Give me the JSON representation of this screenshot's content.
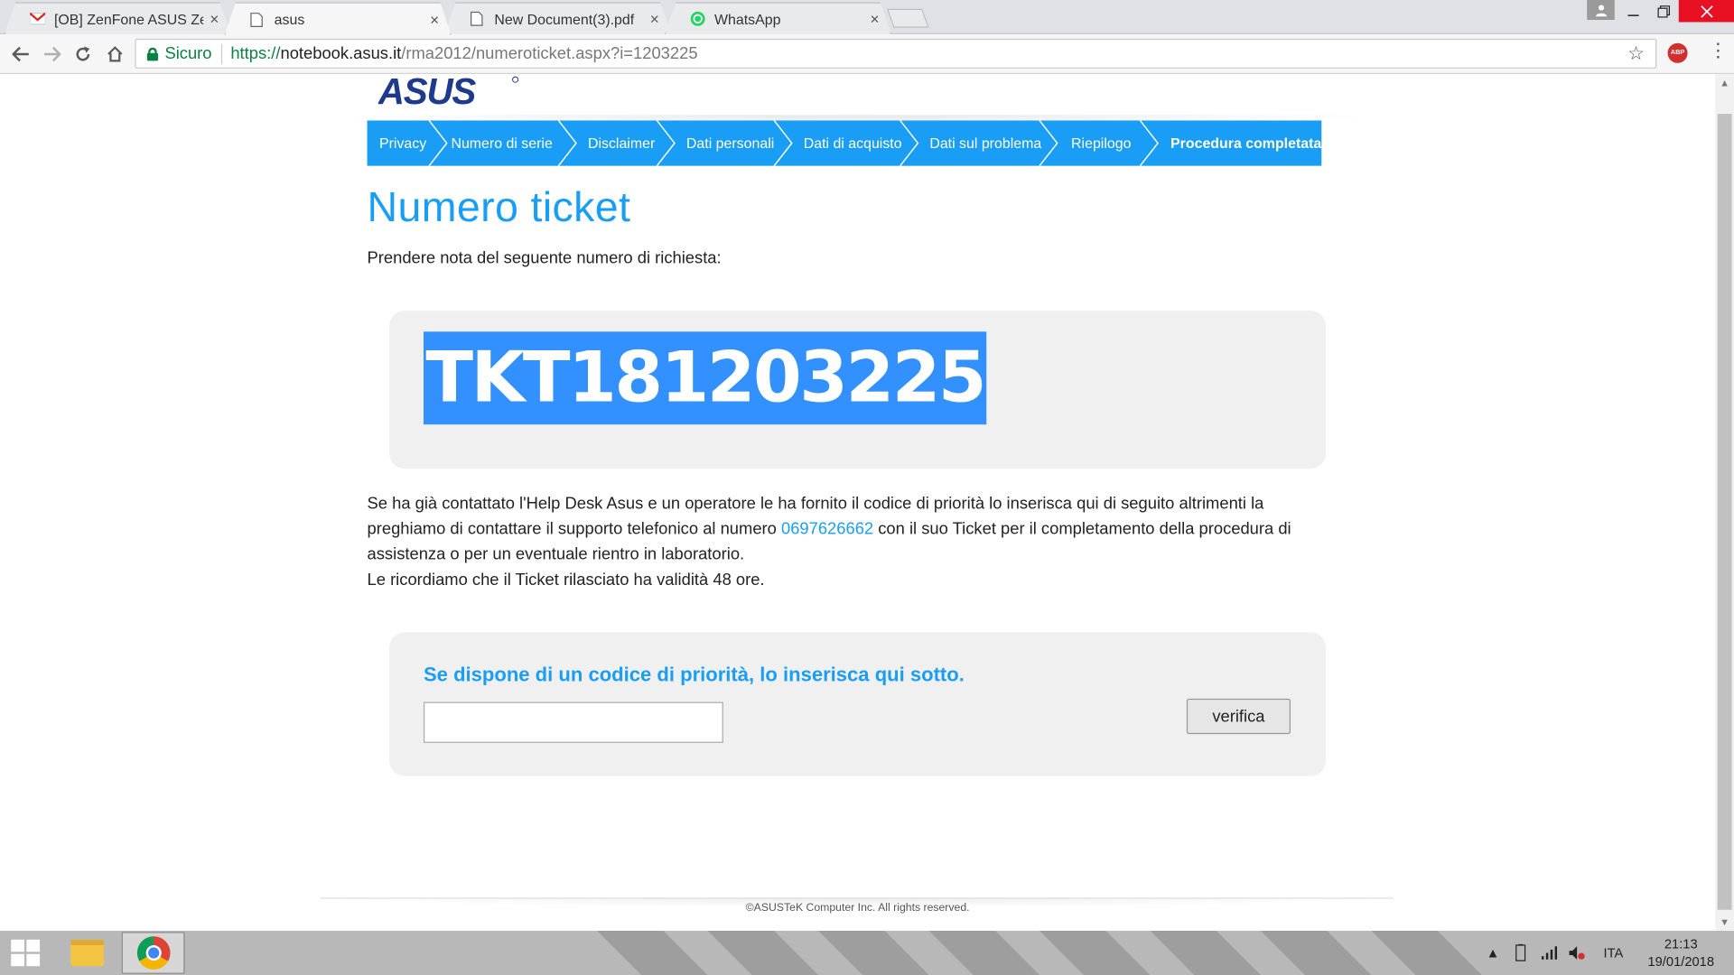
{
  "browser": {
    "tabs": [
      {
        "label": "[OB] ZenFone ASUS Zen",
        "icon": "gmail-icon",
        "active": false
      },
      {
        "label": "asus",
        "icon": "page-icon",
        "active": true
      },
      {
        "label": "New Document(3).pdf",
        "icon": "page-icon",
        "active": false
      },
      {
        "label": "WhatsApp",
        "icon": "whatsapp-icon",
        "active": false
      }
    ],
    "close_glyph": "×",
    "secure_label": "Sicuro",
    "url_scheme": "https://",
    "url_host": "notebook.asus.it",
    "url_path": "/rma2012/numeroticket.aspx?i=1203225",
    "abp_label": "ABP"
  },
  "page": {
    "logo_text": "ASUS",
    "steps": [
      {
        "label": "Privacy",
        "current": false
      },
      {
        "label": "Numero di serie",
        "current": false
      },
      {
        "label": "Disclaimer",
        "current": false
      },
      {
        "label": "Dati personali",
        "current": false
      },
      {
        "label": "Dati di acquisto",
        "current": false
      },
      {
        "label": "Dati sul problema",
        "current": false
      },
      {
        "label": "Riepilogo",
        "current": false
      },
      {
        "label": "Procedura completata",
        "current": true
      }
    ],
    "title": "Numero ticket",
    "intro": "Prendere nota del seguente numero di richiesta:",
    "ticket_number": "TKT181203225",
    "para_line1": "Se ha già contattato l'Help Desk Asus e un operatore le ha fornito il codice di priorità lo inserisca qui di seguito altrimenti la preghiamo di contattare il supporto telefonico al numero ",
    "phone": "0697626662",
    "para_line2": " con il suo Ticket per il completamento della procedura di assistenza o per un eventuale rientro in laboratorio.",
    "para_line3": "Le ricordiamo che il Ticket rilasciato ha validità 48 ore.",
    "priority_title": "Se dispone di un codice di priorità, lo inserisca qui sotto.",
    "priority_value": "",
    "verify_label": "verifica",
    "copyright": "©ASUSTeK Computer Inc. All rights reserved."
  },
  "taskbar": {
    "language": "ITA",
    "time": "21:13",
    "date": "19/01/2018"
  },
  "colors": {
    "accent": "#1a9ef5",
    "selection": "#3390ff",
    "secure": "#0b8043"
  }
}
